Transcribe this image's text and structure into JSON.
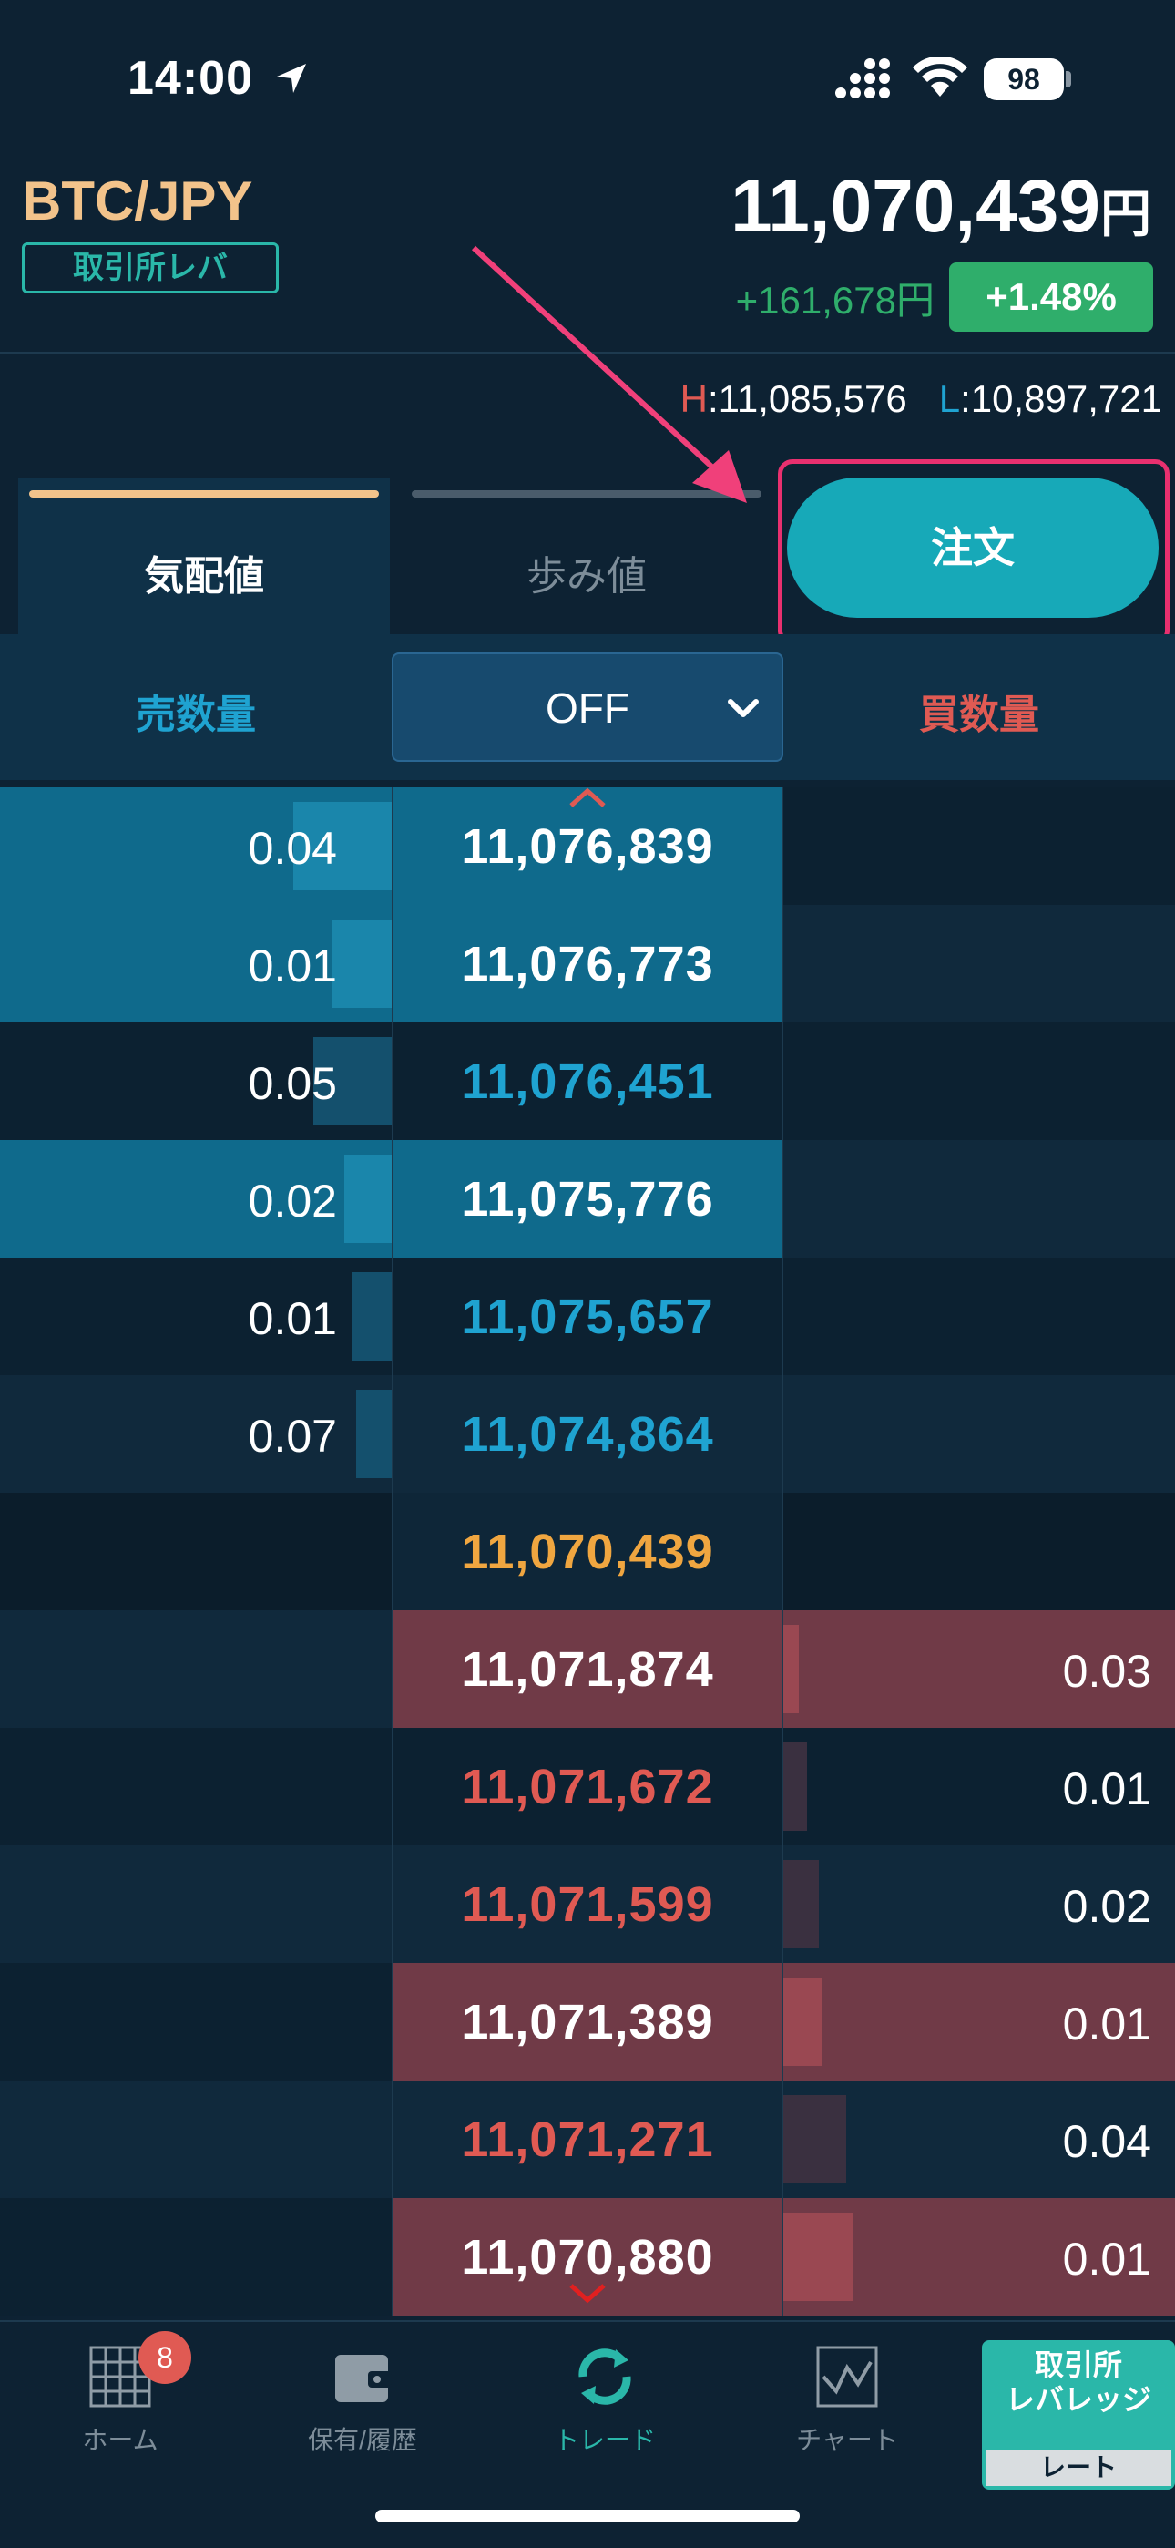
{
  "status_bar": {
    "time": "14:00",
    "battery": "98"
  },
  "header": {
    "pair": "BTC/JPY",
    "market_badge": "取引所レバ",
    "price": "11,070,439",
    "price_unit": "円",
    "change_abs": "+161,678円",
    "change_pct": "+1.48%"
  },
  "high_low": {
    "h_label": "H",
    "h_value": ":11,085,576",
    "l_label": "L",
    "l_value": ":10,897,721"
  },
  "tabs": {
    "quotes": "気配値",
    "trades": "歩み値",
    "order": "注文"
  },
  "columns": {
    "sell": "売数量",
    "buy": "買数量",
    "grouping": "OFF"
  },
  "colors": {
    "bg": "#0d2233",
    "sell_blue": "#1fa3d1",
    "buy_red": "#e05a53",
    "last_orange": "#f0a640",
    "accent_teal": "#17a9b8",
    "highlight_pink": "#e8306f"
  },
  "order_book": [
    {
      "side": "sell",
      "qty": "0.04",
      "price": "11,076,839",
      "highlight": true,
      "bar": 0.25
    },
    {
      "side": "sell",
      "qty": "0.01",
      "price": "11,076,773",
      "highlight": true,
      "bar": 0.15
    },
    {
      "side": "sell",
      "qty": "0.05",
      "price": "11,076,451",
      "highlight": false,
      "bar": 0.2
    },
    {
      "side": "sell",
      "qty": "0.02",
      "price": "11,075,776",
      "highlight": true,
      "bar": 0.12
    },
    {
      "side": "sell",
      "qty": "0.01",
      "price": "11,075,657",
      "highlight": false,
      "bar": 0.1
    },
    {
      "side": "sell",
      "qty": "0.07",
      "price": "11,074,864",
      "highlight": false,
      "bar": 0.09
    },
    {
      "side": "last",
      "qty": "",
      "price": "11,070,439",
      "highlight": false,
      "bar": 0
    },
    {
      "side": "buy",
      "qty": "0.03",
      "price": "11,071,874",
      "highlight": true,
      "bar": 0.04
    },
    {
      "side": "buy",
      "qty": "0.01",
      "price": "11,071,672",
      "highlight": false,
      "bar": 0.06
    },
    {
      "side": "buy",
      "qty": "0.02",
      "price": "11,071,599",
      "highlight": false,
      "bar": 0.09
    },
    {
      "side": "buy",
      "qty": "0.01",
      "price": "11,071,389",
      "highlight": true,
      "bar": 0.1
    },
    {
      "side": "buy",
      "qty": "0.04",
      "price": "11,071,271",
      "highlight": false,
      "bar": 0.16
    },
    {
      "side": "buy",
      "qty": "0.01",
      "price": "11,070,880",
      "highlight": true,
      "bar": 0.18
    }
  ],
  "bottom_nav": {
    "home": "ホーム",
    "home_badge": "8",
    "holdings": "保有/履歴",
    "trade": "トレード",
    "chart": "チャート",
    "rate_line1": "取引所",
    "rate_line2": "レバレッジ",
    "rate_sub": "レート"
  }
}
